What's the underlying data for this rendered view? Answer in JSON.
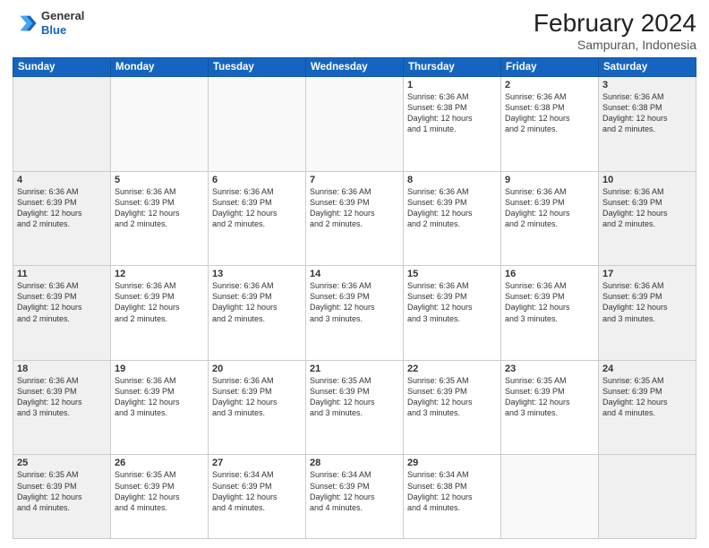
{
  "logo": {
    "general": "General",
    "blue": "Blue"
  },
  "title": "February 2024",
  "subtitle": "Sampuran, Indonesia",
  "days": [
    "Sunday",
    "Monday",
    "Tuesday",
    "Wednesday",
    "Thursday",
    "Friday",
    "Saturday"
  ],
  "weeks": [
    [
      {
        "day": "",
        "info": ""
      },
      {
        "day": "",
        "info": ""
      },
      {
        "day": "",
        "info": ""
      },
      {
        "day": "",
        "info": ""
      },
      {
        "day": "1",
        "info": "Sunrise: 6:36 AM\nSunset: 6:38 PM\nDaylight: 12 hours\nand 1 minute."
      },
      {
        "day": "2",
        "info": "Sunrise: 6:36 AM\nSunset: 6:38 PM\nDaylight: 12 hours\nand 2 minutes."
      },
      {
        "day": "3",
        "info": "Sunrise: 6:36 AM\nSunset: 6:38 PM\nDaylight: 12 hours\nand 2 minutes."
      }
    ],
    [
      {
        "day": "4",
        "info": "Sunrise: 6:36 AM\nSunset: 6:39 PM\nDaylight: 12 hours\nand 2 minutes."
      },
      {
        "day": "5",
        "info": "Sunrise: 6:36 AM\nSunset: 6:39 PM\nDaylight: 12 hours\nand 2 minutes."
      },
      {
        "day": "6",
        "info": "Sunrise: 6:36 AM\nSunset: 6:39 PM\nDaylight: 12 hours\nand 2 minutes."
      },
      {
        "day": "7",
        "info": "Sunrise: 6:36 AM\nSunset: 6:39 PM\nDaylight: 12 hours\nand 2 minutes."
      },
      {
        "day": "8",
        "info": "Sunrise: 6:36 AM\nSunset: 6:39 PM\nDaylight: 12 hours\nand 2 minutes."
      },
      {
        "day": "9",
        "info": "Sunrise: 6:36 AM\nSunset: 6:39 PM\nDaylight: 12 hours\nand 2 minutes."
      },
      {
        "day": "10",
        "info": "Sunrise: 6:36 AM\nSunset: 6:39 PM\nDaylight: 12 hours\nand 2 minutes."
      }
    ],
    [
      {
        "day": "11",
        "info": "Sunrise: 6:36 AM\nSunset: 6:39 PM\nDaylight: 12 hours\nand 2 minutes."
      },
      {
        "day": "12",
        "info": "Sunrise: 6:36 AM\nSunset: 6:39 PM\nDaylight: 12 hours\nand 2 minutes."
      },
      {
        "day": "13",
        "info": "Sunrise: 6:36 AM\nSunset: 6:39 PM\nDaylight: 12 hours\nand 2 minutes."
      },
      {
        "day": "14",
        "info": "Sunrise: 6:36 AM\nSunset: 6:39 PM\nDaylight: 12 hours\nand 3 minutes."
      },
      {
        "day": "15",
        "info": "Sunrise: 6:36 AM\nSunset: 6:39 PM\nDaylight: 12 hours\nand 3 minutes."
      },
      {
        "day": "16",
        "info": "Sunrise: 6:36 AM\nSunset: 6:39 PM\nDaylight: 12 hours\nand 3 minutes."
      },
      {
        "day": "17",
        "info": "Sunrise: 6:36 AM\nSunset: 6:39 PM\nDaylight: 12 hours\nand 3 minutes."
      }
    ],
    [
      {
        "day": "18",
        "info": "Sunrise: 6:36 AM\nSunset: 6:39 PM\nDaylight: 12 hours\nand 3 minutes."
      },
      {
        "day": "19",
        "info": "Sunrise: 6:36 AM\nSunset: 6:39 PM\nDaylight: 12 hours\nand 3 minutes."
      },
      {
        "day": "20",
        "info": "Sunrise: 6:36 AM\nSunset: 6:39 PM\nDaylight: 12 hours\nand 3 minutes."
      },
      {
        "day": "21",
        "info": "Sunrise: 6:35 AM\nSunset: 6:39 PM\nDaylight: 12 hours\nand 3 minutes."
      },
      {
        "day": "22",
        "info": "Sunrise: 6:35 AM\nSunset: 6:39 PM\nDaylight: 12 hours\nand 3 minutes."
      },
      {
        "day": "23",
        "info": "Sunrise: 6:35 AM\nSunset: 6:39 PM\nDaylight: 12 hours\nand 3 minutes."
      },
      {
        "day": "24",
        "info": "Sunrise: 6:35 AM\nSunset: 6:39 PM\nDaylight: 12 hours\nand 4 minutes."
      }
    ],
    [
      {
        "day": "25",
        "info": "Sunrise: 6:35 AM\nSunset: 6:39 PM\nDaylight: 12 hours\nand 4 minutes."
      },
      {
        "day": "26",
        "info": "Sunrise: 6:35 AM\nSunset: 6:39 PM\nDaylight: 12 hours\nand 4 minutes."
      },
      {
        "day": "27",
        "info": "Sunrise: 6:34 AM\nSunset: 6:39 PM\nDaylight: 12 hours\nand 4 minutes."
      },
      {
        "day": "28",
        "info": "Sunrise: 6:34 AM\nSunset: 6:39 PM\nDaylight: 12 hours\nand 4 minutes."
      },
      {
        "day": "29",
        "info": "Sunrise: 6:34 AM\nSunset: 6:38 PM\nDaylight: 12 hours\nand 4 minutes."
      },
      {
        "day": "",
        "info": ""
      },
      {
        "day": "",
        "info": ""
      }
    ]
  ]
}
